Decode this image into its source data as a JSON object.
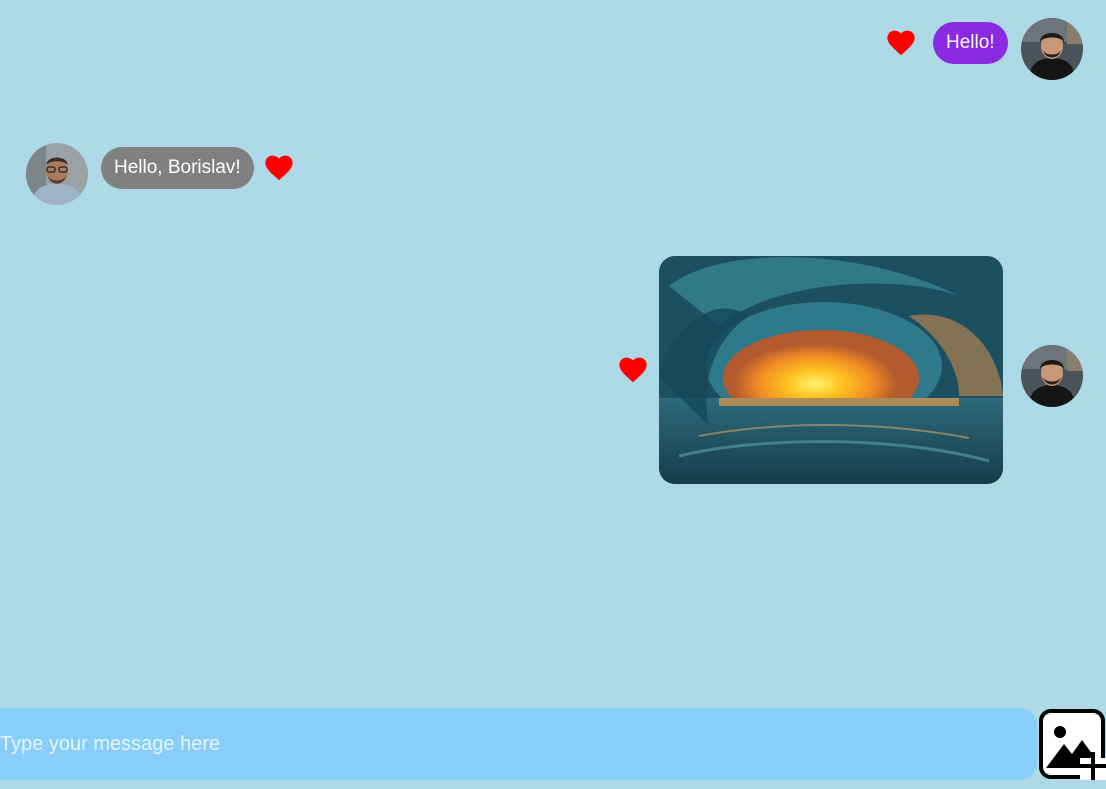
{
  "conversation": {
    "messages": [
      {
        "sender": "me",
        "type": "text",
        "text": "Hello!",
        "liked": true
      },
      {
        "sender": "them",
        "type": "text",
        "text": "Hello, Borislav!",
        "liked": true
      },
      {
        "sender": "me",
        "type": "image",
        "image_subject": "ocean-wave-sunset",
        "liked": true
      }
    ]
  },
  "composer": {
    "placeholder": "Type your message here"
  },
  "icons": {
    "like": "heart-icon",
    "attach": "add-image-icon"
  },
  "colors": {
    "background": "#add8e6",
    "my_bubble": "#8a2be2",
    "their_bubble": "#808080",
    "heart": "#ff0000",
    "composer": "#87cefa"
  }
}
